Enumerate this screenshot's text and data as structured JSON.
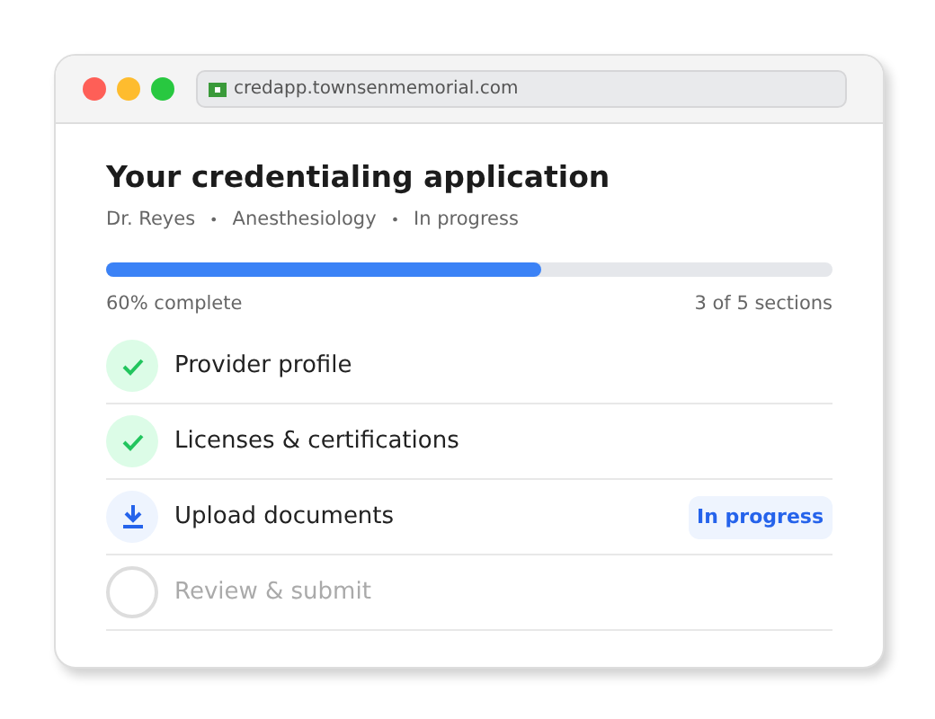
{
  "window": {
    "url": "credapp.townsenmemorial.com"
  },
  "title": "Your credentialing application",
  "meta": [
    {
      "kind": "text",
      "text": "Dr. Reyes"
    },
    {
      "kind": "separator",
      "text": "•"
    },
    {
      "kind": "text",
      "text": "Anesthesiology"
    },
    {
      "kind": "separator",
      "text": "•"
    },
    {
      "kind": "text",
      "text": "In progress"
    }
  ],
  "progress": {
    "level": 0.6,
    "label": "60% complete",
    "sections": "3 of 5 sections"
  },
  "steps": [
    {
      "label": "Provider profile",
      "kind": "done"
    },
    {
      "label": "Licenses & certifications",
      "kind": "done"
    },
    {
      "label": "Upload documents",
      "kind": "current",
      "badge": "In progress"
    },
    {
      "label": "Review & submit",
      "kind": "pending"
    }
  ]
}
